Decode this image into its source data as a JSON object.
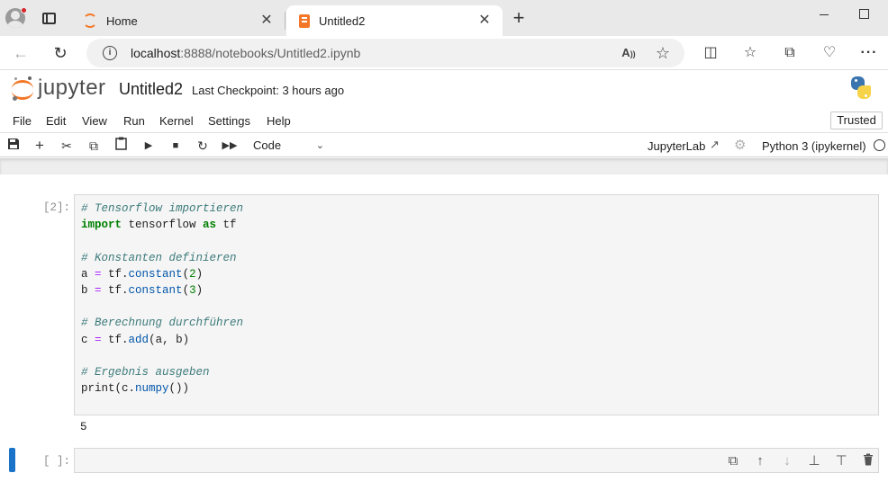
{
  "browser": {
    "tabs": [
      {
        "title": "Home",
        "favicon": "jupyter-icon",
        "active": false
      },
      {
        "title": "Untitled2",
        "favicon": "notebook-icon",
        "active": true
      }
    ],
    "new_tab_symbol": "+",
    "close_symbol": "✕",
    "url_host": "localhost",
    "url_rest": ":8888/notebooks/Untitled2.ipynb"
  },
  "jupyter": {
    "logo_text": "jupyter",
    "notebook_name": "Untitled2",
    "checkpoint": "Last Checkpoint: 3 hours ago",
    "menu": [
      "File",
      "Edit",
      "View",
      "Run",
      "Kernel",
      "Settings",
      "Help"
    ],
    "trusted_label": "Trusted",
    "cell_type": "Code",
    "jupyterlab_label": "JupyterLab",
    "kernel_name": "Python 3 (ipykernel)",
    "accent_color": "#f37726",
    "selection_color": "#1a73c8"
  },
  "cells": {
    "code_prompt": "[2]:",
    "code_lines": [
      "# Tensorflow importieren",
      "import tensorflow as tf",
      "",
      "# Konstanten definieren",
      "a = tf.constant(2)",
      "b = tf.constant(3)",
      "",
      "# Berechnung durchführen",
      "c = tf.add(a, b)",
      "",
      "# Ergebnis ausgeben",
      "print(c.numpy())"
    ],
    "output": "5",
    "empty_prompt": "[ ]:"
  }
}
